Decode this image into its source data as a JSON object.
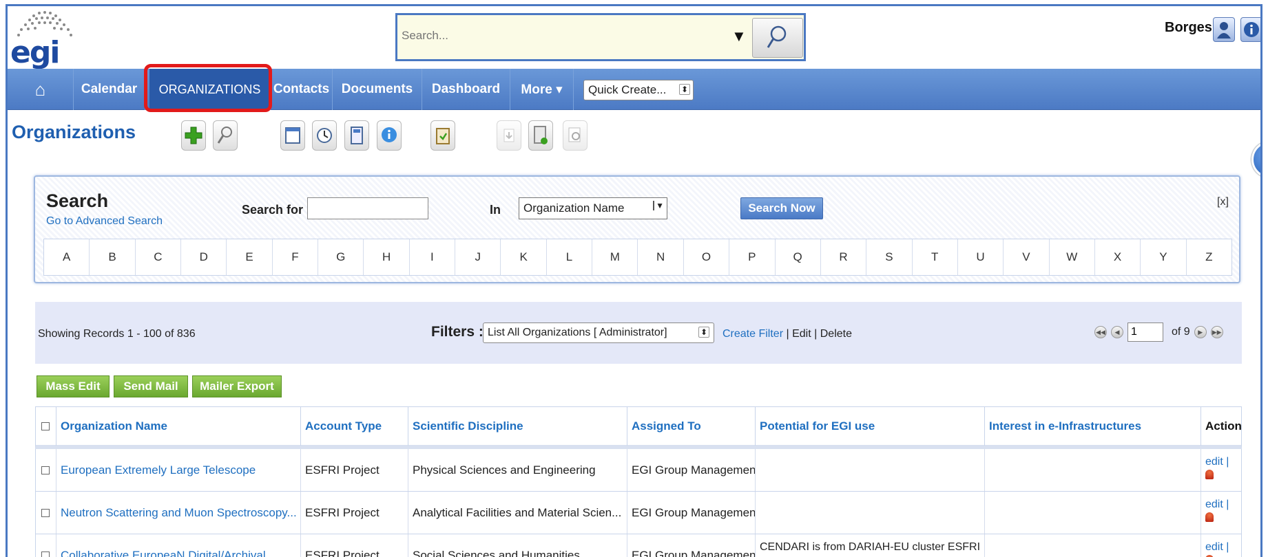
{
  "header": {
    "logo_text": "egi",
    "search_placeholder": "Search...",
    "user_name": "Borges"
  },
  "nav": {
    "items": [
      {
        "label": "⌂",
        "name": "home"
      },
      {
        "label": "Calendar",
        "name": "calendar"
      },
      {
        "label": "ORGANIZATIONS",
        "name": "organizations",
        "active": true
      },
      {
        "label": "Contacts",
        "name": "contacts"
      },
      {
        "label": "Documents",
        "name": "documents"
      },
      {
        "label": "Dashboard",
        "name": "dashboard"
      },
      {
        "label": "More ▾",
        "name": "more"
      }
    ],
    "quick_create": "Quick Create..."
  },
  "module": {
    "title": "Organizations"
  },
  "search_panel": {
    "title": "Search",
    "advanced_link": "Go to Advanced Search",
    "search_for_label": "Search for",
    "in_label": "In",
    "field_value": "Organization Name",
    "button": "Search Now",
    "close": "[x]",
    "letters": [
      "A",
      "B",
      "C",
      "D",
      "E",
      "F",
      "G",
      "H",
      "I",
      "J",
      "K",
      "L",
      "M",
      "N",
      "O",
      "P",
      "Q",
      "R",
      "S",
      "T",
      "U",
      "V",
      "W",
      "X",
      "Y",
      "Z"
    ]
  },
  "listbar": {
    "showing": "Showing Records 1 - 100 of 836",
    "filters_label": "Filters :",
    "filter_value": "List All Organizations [ Administrator]",
    "create_filter": "Create Filter",
    "edit": "Edit",
    "delete": "Delete",
    "sep": "|",
    "page_value": "1",
    "of_pages": "of 9"
  },
  "mass_buttons": {
    "mass_edit": "Mass Edit",
    "send_mail": "Send Mail",
    "mailer_export": "Mailer Export"
  },
  "table": {
    "columns": [
      "Organization Name",
      "Account Type",
      "Scientific Discipline",
      "Assigned To",
      "Potential for EGI use",
      "Interest in e-Infrastructures",
      "Action"
    ],
    "rows": [
      {
        "name": "European Extremely Large Telescope",
        "type": "ESFRI Project",
        "discipline": "Physical Sciences and Engineering",
        "assigned": "EGI Group Management",
        "potential": "",
        "interest": "",
        "action": "edit |"
      },
      {
        "name": "Neutron Scattering and Muon Spectroscopy...",
        "type": "ESFRI Project",
        "discipline": "Analytical Facilities and Material Scien...",
        "assigned": "EGI Group Management",
        "potential": "",
        "interest": "",
        "action": "edit |"
      },
      {
        "name": "Collaborative EuropeaN Digital/Archival ...",
        "type": "ESFRI Project",
        "discipline": "Social Sciences and Humanities",
        "assigned": "EGI Group Management",
        "potential": "CENDARI is from DARIAH-EU cluster ESFRI",
        "interest": "",
        "action": "edit |"
      }
    ]
  }
}
